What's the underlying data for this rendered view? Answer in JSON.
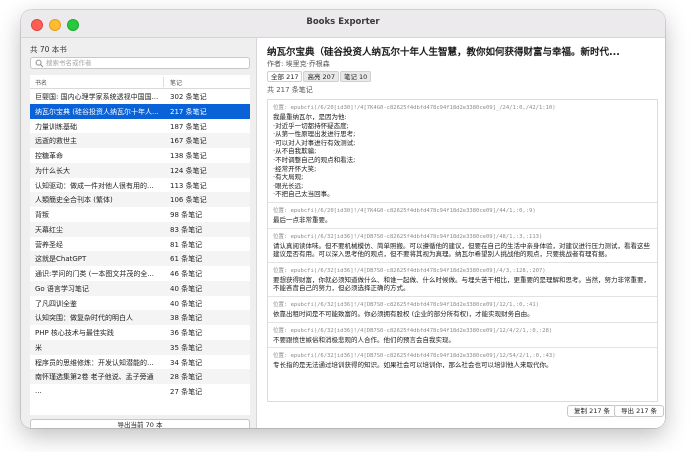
{
  "window": {
    "title": "Books Exporter"
  },
  "sidebar": {
    "book_count": "共 70 本书",
    "search_placeholder": "搜索书名或作者",
    "col_name": "书名",
    "col_notes": "笔记",
    "books": [
      {
        "name": "巨婴国: 国内心理学家系统透视中国国...",
        "notes": "302 条笔记"
      },
      {
        "name": "纳瓦尔宝典 (硅谷投资人纳瓦尔十年人...",
        "notes": "217 条笔记",
        "selected": true
      },
      {
        "name": "力量训练基础",
        "notes": "187 条笔记"
      },
      {
        "name": "远逝的救世主",
        "notes": "167 条笔记"
      },
      {
        "name": "控糖革命",
        "notes": "138 条笔记"
      },
      {
        "name": "为什么长大",
        "notes": "124 条笔记"
      },
      {
        "name": "认知驱动：做成一件对他人很有用的...",
        "notes": "113 条笔记"
      },
      {
        "name": "人類簡史全合刊本 (繁体)",
        "notes": "106 条笔记"
      },
      {
        "name": "背叛",
        "notes": "98 条笔记"
      },
      {
        "name": "天幕红尘",
        "notes": "83 条笔记"
      },
      {
        "name": "营养圣经",
        "notes": "81 条笔记"
      },
      {
        "name": "这就是ChatGPT",
        "notes": "61 条笔记"
      },
      {
        "name": "通识:学问的门类 (一本图文并茂的全...",
        "notes": "46 条笔记"
      },
      {
        "name": "Go 语言学习笔记",
        "notes": "40 条笔记"
      },
      {
        "name": "了凡四训全鉴",
        "notes": "40 条笔记"
      },
      {
        "name": "认知突围：做复杂时代的明白人",
        "notes": "38 条笔记"
      },
      {
        "name": "PHP 核心技术与最佳实践",
        "notes": "36 条笔记"
      },
      {
        "name": "米",
        "notes": "35 条笔记"
      },
      {
        "name": "程序员的思维修炼：开发认知潜能的...",
        "notes": "34 条笔记"
      },
      {
        "name": "南怀瑾选集第2卷 老子他说、孟子旁通",
        "notes": "28 条笔记"
      },
      {
        "name": "...",
        "notes": "27 条笔记"
      }
    ],
    "export_all_label": "导出当前 70 本"
  },
  "main": {
    "book_title": "纳瓦尔宝典（硅谷投资人纳瓦尔十年人生智慧，教你如何获得财富与幸福。新时代...",
    "author": "作者: 埃里克·乔根森",
    "tabs": [
      {
        "label": "全部 217",
        "active": true
      },
      {
        "label": "高亮 207"
      },
      {
        "label": "笔记 10"
      }
    ],
    "total_notes": "共 217 条笔记",
    "notes": [
      {
        "loc": "位置: epubcfi(/6/20[id30]!/4[7K4G0-c82625f4dbfd478c94f18d2e3380ce09]_/24/1:0,/42/1:10)",
        "text": "我最重纳瓦尔，是因为他:\n·对近乎一切都持怀疑态度;\n·从第一性原理出发进行思考;\n·可以对人对事进行有效测试;\n·从不自我欺骗;\n·不时调整自己的观点和看法;\n·经常开怀大笑;\n·有大局观;\n·眼光长远;\n·不把自己太当回事。"
      },
      {
        "loc": "位置: epubcfi(/6/20[id30]!/4[7K4G0-c82625f4dbfd478c94f18d2e3380ce09]/44/1,:0,:9)",
        "text": "最后一点非常重要。"
      },
      {
        "loc": "位置: epubcfi(/6/32[id36]!/4[DB7S0-c82625f4dbfd478c94f18d2e3380ce09]/48/1,:3,:113)",
        "text": "请认真阅读体味。但不要机械模仿、简单照搬。可以遵循他的建议，但要在自己的生活中亲身体验，对建议进行压力测试，看看这些建议是否有用。可以深入思考他的观点，但不要将其视为真理。纳瓦尔希望别人挑战他的观点，只要挑战者有理有据。"
      },
      {
        "loc": "位置: epubcfi(/6/32[id36]!/4[DB7S0-c82625f4dbfd478c94f18d2e3380ce09]/4/3,:128,:207)",
        "text": "要想获得财富，你就必须知道做什么、和谁一起做、什么时候做。与埋头苦干相比，更重要的是理解和思考。当然，努力非常重要，不能吝啬自己的努力，但必须选择正确的方式。"
      },
      {
        "loc": "位置: epubcfi(/6/32[id36]!/4[DB7S0-c82625f4dbfd478c94f18d2e3380ce09]/12/1,:0,:41)",
        "text": "依靠出租时间是不可能致富的。你必须拥有股权 (企业的部分所有权)，才能实现财务自由。"
      },
      {
        "loc": "位置: epubcfi(/6/32[id36]!/4[DB7S0-c82625f4dbfd478c94f18d2e3380ce09]/12/4/2/1,:0,:28)",
        "text": "不要跟愤世嫉俗和消极悲观的人合作。他们的预言会自我实现。"
      },
      {
        "loc": "位置: epubcfi(/6/32[id36]!/4[DB7S0-c82625f4dbfd478c94f18d2e3380ce09]/12/54/2/1,:0,:43)",
        "text": "专长指的是无法通过培训获得的知识。如果社会可以培训你，那么社会也可以培训他人来取代你。"
      }
    ],
    "copy_label": "复制 217 条",
    "export_label": "导出 217 条"
  }
}
